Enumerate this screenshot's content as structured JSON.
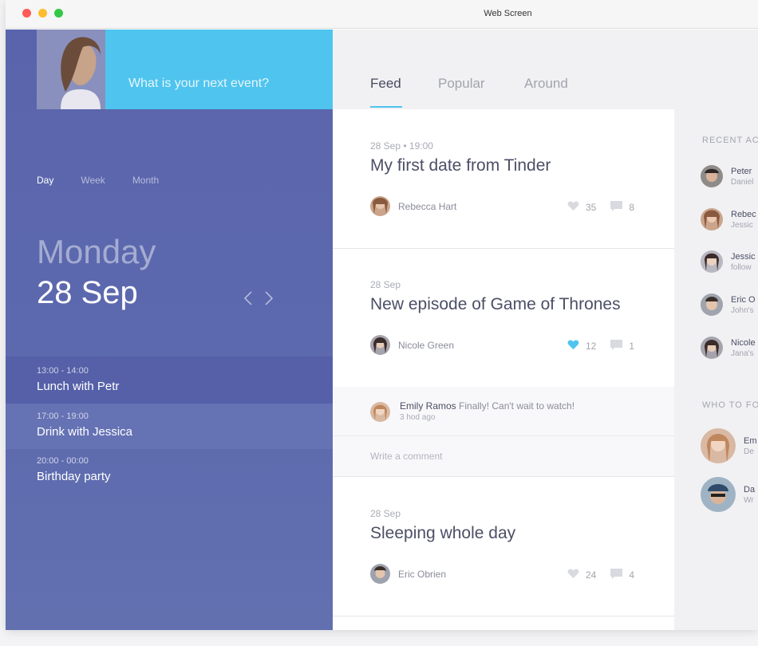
{
  "window": {
    "title": "Web Screen"
  },
  "left": {
    "prompt": "What is your next event?",
    "period_tabs": [
      "Day",
      "Week",
      "Month"
    ],
    "day_name": "Monday",
    "day_date": "28 Sep",
    "events": [
      {
        "time": "13:00 - 14:00",
        "title": "Lunch with Petr"
      },
      {
        "time": "17:00 - 19:00",
        "title": "Drink with Jessica"
      },
      {
        "time": "20:00 - 00:00",
        "title": "Birthday party"
      }
    ]
  },
  "tabs": [
    "Feed",
    "Popular",
    "Around"
  ],
  "feed": [
    {
      "date": "28 Sep • 19:00",
      "title": "My first date from Tinder",
      "author": "Rebecca Hart",
      "likes": "35",
      "comments": "8"
    },
    {
      "date": "28 Sep",
      "title": "New episode of Game of Thrones",
      "author": "Nicole Green",
      "likes": "12",
      "comments": "1"
    },
    {
      "date": "28 Sep",
      "title": "Sleeping whole day",
      "author": "Eric Obrien",
      "likes": "24",
      "comments": "4"
    }
  ],
  "comment": {
    "author": "Emily Ramos",
    "text": "Finally! Can't wait to watch!",
    "time": "3 hod ago"
  },
  "write_placeholder": "Write a comment",
  "sidebar": {
    "recent_title": "RECENT AC",
    "recent": [
      {
        "name": "Peter",
        "sub": "Daniel"
      },
      {
        "name": "Rebec",
        "sub": "Jessic"
      },
      {
        "name": "Jessic",
        "sub": "follow"
      },
      {
        "name": "Eric O",
        "sub": "John's"
      },
      {
        "name": "Nicole",
        "sub": "Jana's"
      }
    ],
    "follow_title": "WHO TO FO",
    "follow": [
      {
        "name": "Em",
        "sub": "De"
      },
      {
        "name": "Da",
        "sub": "Wr"
      }
    ]
  },
  "colors": {
    "accent": "#4fc4ee",
    "panel": "#5a64ac",
    "heart_active": "#4fc4ee"
  }
}
